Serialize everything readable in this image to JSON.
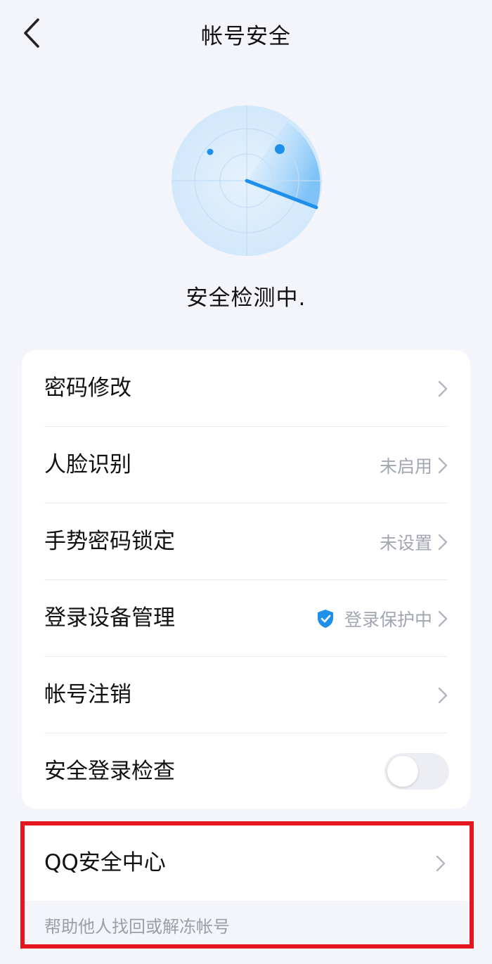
{
  "header": {
    "title": "帐号安全"
  },
  "scan": {
    "status": "安全检测中."
  },
  "settings": [
    {
      "label": "密码修改",
      "value": ""
    },
    {
      "label": "人脸识别",
      "value": "未启用"
    },
    {
      "label": "手势密码锁定",
      "value": "未设置"
    },
    {
      "label": "登录设备管理",
      "value": "登录保护中"
    },
    {
      "label": "帐号注销",
      "value": ""
    },
    {
      "label": "安全登录检查",
      "toggle": false
    }
  ],
  "security_center": {
    "label": "QQ安全中心",
    "hint": "帮助他人找回或解冻帐号"
  },
  "colors": {
    "accent": "#1e8fea",
    "highlight": "#e4161e",
    "background": "#f4f5fa"
  },
  "icons": {
    "back": "chevron-left-icon",
    "row_arrow": "chevron-right-icon",
    "protection": "shield-check-icon"
  }
}
